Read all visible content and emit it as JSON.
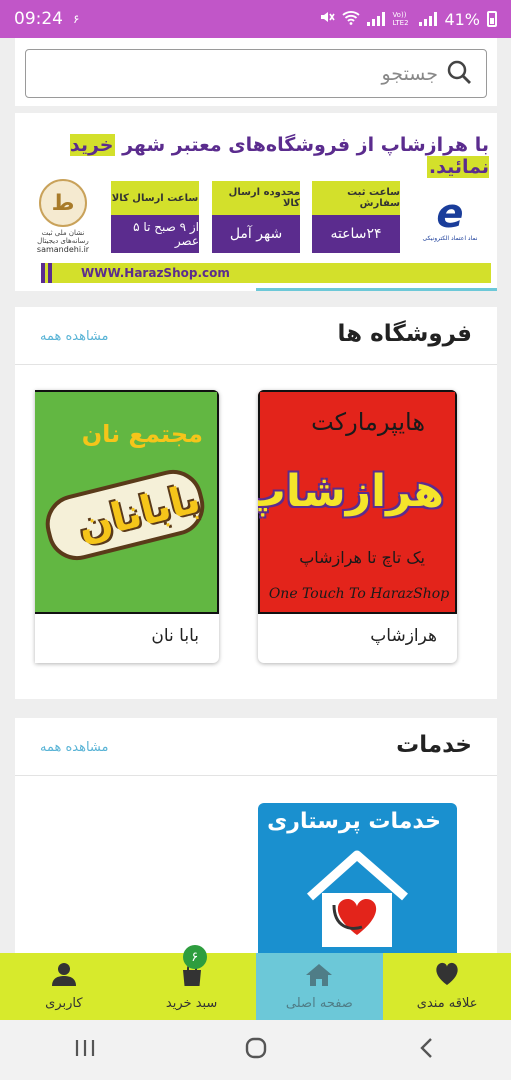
{
  "status_bar": {
    "time": "09:24",
    "extra_icon": "۶",
    "network": "Vo))\nLTE2",
    "battery": "41%"
  },
  "search": {
    "placeholder": "جستجو"
  },
  "banner": {
    "headline_prefix": "با هرازشاپ از فروشگاه‌های معتبر شهر ",
    "headline_highlight": "خرید نمائید.",
    "boxes": [
      {
        "top": "ساعت ثبت سفارش",
        "bottom": "۲۴ساعته"
      },
      {
        "top": "محدوده ارسال کالا",
        "bottom": "شهر آمل"
      },
      {
        "top": "ساعت ارسال کالا",
        "bottom": "از ۹ صبح تا ۵ عصر"
      }
    ],
    "url": "WWW.HarazShop.com",
    "seal_text": "نشان ملی ثبت رسانه‌های دیجیتال",
    "seal_url": "samandehi.ir",
    "enamad_text": "نماد اعتماد الکترونیکی"
  },
  "stores": {
    "title": "فروشگاه ها",
    "see_all": "مشاهده همه",
    "items": [
      {
        "name": "هرازشاپ",
        "img_l1": "هایپرمارکت",
        "img_l2": "هرازشاپ",
        "img_l3": "یک تاچ تا هرازشاپ",
        "img_l4": "One Touch To HarazShop"
      },
      {
        "name": "بابا نان",
        "img_l1": "مجتمع نان",
        "img_l2": "بابانان"
      }
    ]
  },
  "services": {
    "title": "خدمات",
    "see_all": "مشاهده همه",
    "items": [
      {
        "img_title": "خدمات پرستاری"
      }
    ]
  },
  "bottom_nav": {
    "favorites": "علاقه مندی",
    "home": "صفحه اصلی",
    "cart": "سبد خرید",
    "cart_count": "۶",
    "user": "کاربری"
  },
  "colors": {
    "status_bar": "#c156c8",
    "nav_bg": "#d7ea2c",
    "nav_active": "#6cc8d8",
    "brand_purple": "#5b2c8e",
    "link": "#5ab4d6"
  }
}
